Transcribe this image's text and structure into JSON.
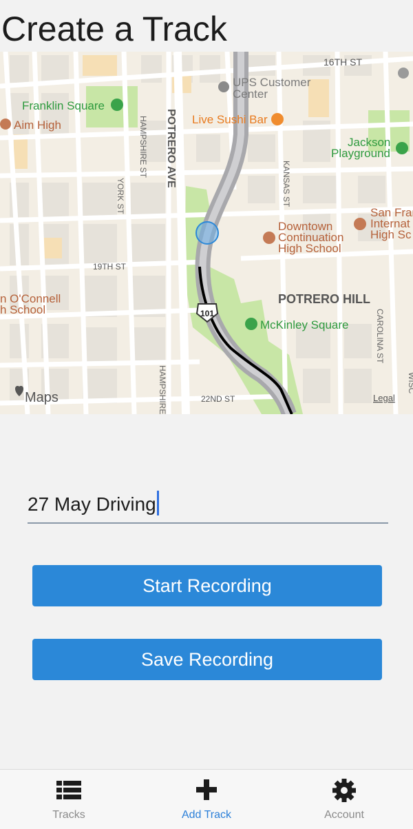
{
  "header": {
    "title": "Create a Track"
  },
  "map": {
    "labels": {
      "sixteenth_st": "16TH ST",
      "ups": "UPS Customer",
      "ups2": "Center",
      "franklin_square": "Franklin Square",
      "aim_high": "Aim High",
      "live_sushi": "Live Sushi Bar",
      "jackson_playground": "Jackson",
      "jackson_playground2": "Playground",
      "potrero_ave": "POTRERO AVE",
      "hampshire_st": "HAMPSHIRE ST",
      "york_st": "YORK ST",
      "kansas_st": "KANSAS ST",
      "downtown_school": "Downtown",
      "downtown_school2": "Continuation",
      "downtown_school3": "High School",
      "san_fran": "San Fran",
      "internat": "Internat",
      "high_sc": "High Sc",
      "nineteenth_st": "19TH ST",
      "oconnell": "n O'Connell",
      "oconnell2": "h School",
      "potrero_hill": "POTRERO HILL",
      "highway": "101",
      "mckinley": "McKinley Square",
      "carolina_st": "CAROLINA ST",
      "twenty_second_st": "22ND ST",
      "hampshire_st2": "HAMPSHIRE",
      "maps_logo": "Maps",
      "legal": "Legal",
      "wisc": "WISC"
    },
    "colors": {
      "land": "#f3eee4",
      "park": "#c8e6a6",
      "road": "#ffffff",
      "highway": "#a8a8ac",
      "track": "#000000",
      "location": "#6aaeea"
    }
  },
  "form": {
    "track_name_value": "27 May Driving",
    "start_button": "Start Recording",
    "save_button": "Save Recording"
  },
  "tabbar": {
    "tabs": [
      {
        "label": "Tracks",
        "icon": "list-icon",
        "active": false
      },
      {
        "label": "Add Track",
        "icon": "plus-icon",
        "active": true
      },
      {
        "label": "Account",
        "icon": "gear-icon",
        "active": false
      }
    ]
  }
}
